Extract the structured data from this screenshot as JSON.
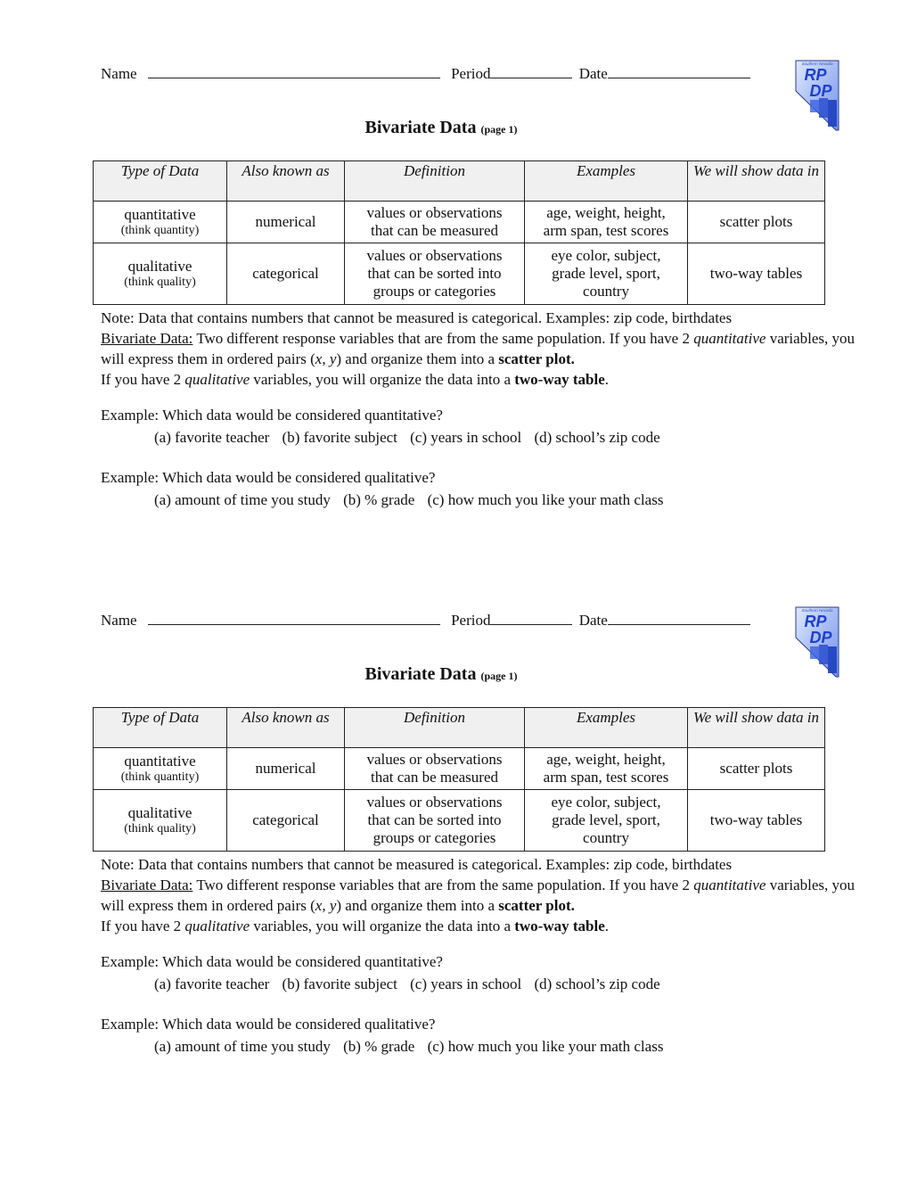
{
  "sheets": [
    {
      "header": {
        "name_label": "Name",
        "period_label": "Period",
        "date_label": "Date"
      },
      "logo": {
        "top_text": "Southern Nevada",
        "letters_top": "RP",
        "letters_bottom": "DP"
      },
      "title": {
        "main": "Bivariate Data",
        "sub": "(page 1)"
      },
      "table": {
        "headers": [
          "Type of Data",
          "Also known as",
          "Definition",
          "Examples",
          "We will show data in"
        ],
        "rows": [
          {
            "type": "quantitative",
            "type_note": "(think quantity)",
            "aka": "numerical",
            "definition": [
              "values or observations",
              "that can be measured"
            ],
            "examples": [
              "age, weight, height,",
              "arm span, test scores"
            ],
            "show_in": "scatter plots"
          },
          {
            "type": "qualitative",
            "type_note": "(think quality)",
            "aka": "categorical",
            "definition": [
              "values or observations",
              "that can be sorted into",
              "groups or categories"
            ],
            "examples": [
              "eye color, subject,",
              "grade level, sport,",
              "country"
            ],
            "show_in": "two-way tables"
          }
        ]
      },
      "notes": {
        "note": "Note:  Data that contains numbers that cannot be measured is categorical.  Examples: zip code, birthdates",
        "bivariate_term": "Bivariate Data:",
        "bivariate_text1": " Two different response variables that are from the same population.  If you have 2 ",
        "quantitative_word": "quantitative",
        "bivariate_text2": " variables, you will express them in ordered pairs (",
        "x": "x",
        "comma": ", ",
        "y": "y",
        "bivariate_text3": ") and organize them into a ",
        "scatter_plot": "scatter plot.",
        "line4_start": "If you have 2 ",
        "qualitative_word": "qualitative",
        "line4_mid": " variables, you will organize the data into a ",
        "two_way_table": "two-way table",
        "line4_end": "."
      },
      "examples": [
        {
          "question": "Example:  Which data would be considered quantitative?",
          "options": [
            "(a) favorite teacher",
            "(b) favorite subject",
            "(c) years in school",
            "(d) school’s zip code"
          ]
        },
        {
          "question": "Example:  Which data would be considered qualitative?",
          "options": [
            "(a) amount of time you study",
            "(b) % grade",
            "(c) how much you like your math class"
          ]
        }
      ]
    }
  ]
}
